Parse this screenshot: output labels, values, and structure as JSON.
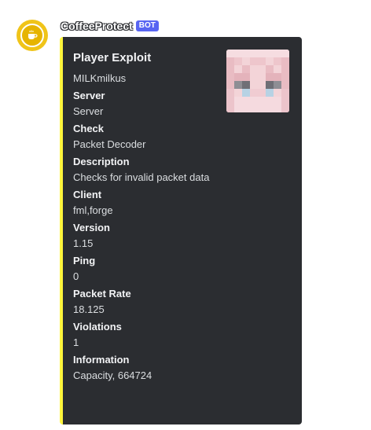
{
  "author": {
    "name": "CoffeeProtect",
    "badge": "BOT",
    "avatar_icon": "coffee-cup-icon"
  },
  "embed": {
    "accent_color": "#fef53c",
    "title": "Player Exploit",
    "description": "MILKmilkus",
    "thumbnail_icon": "player-skin-face-icon",
    "fields": [
      {
        "name": "Server",
        "value": "Server"
      },
      {
        "name": "Check",
        "value": "Packet Decoder"
      },
      {
        "name": "Description",
        "value": "Checks for invalid packet data"
      },
      {
        "name": "Client",
        "value": "fml,forge"
      },
      {
        "name": "Version",
        "value": "1.15"
      },
      {
        "name": "Ping",
        "value": "0"
      },
      {
        "name": "Packet Rate",
        "value": "18.125"
      },
      {
        "name": "Violations",
        "value": "1"
      },
      {
        "name": "Information",
        "value": "Capacity, 664724"
      }
    ]
  }
}
